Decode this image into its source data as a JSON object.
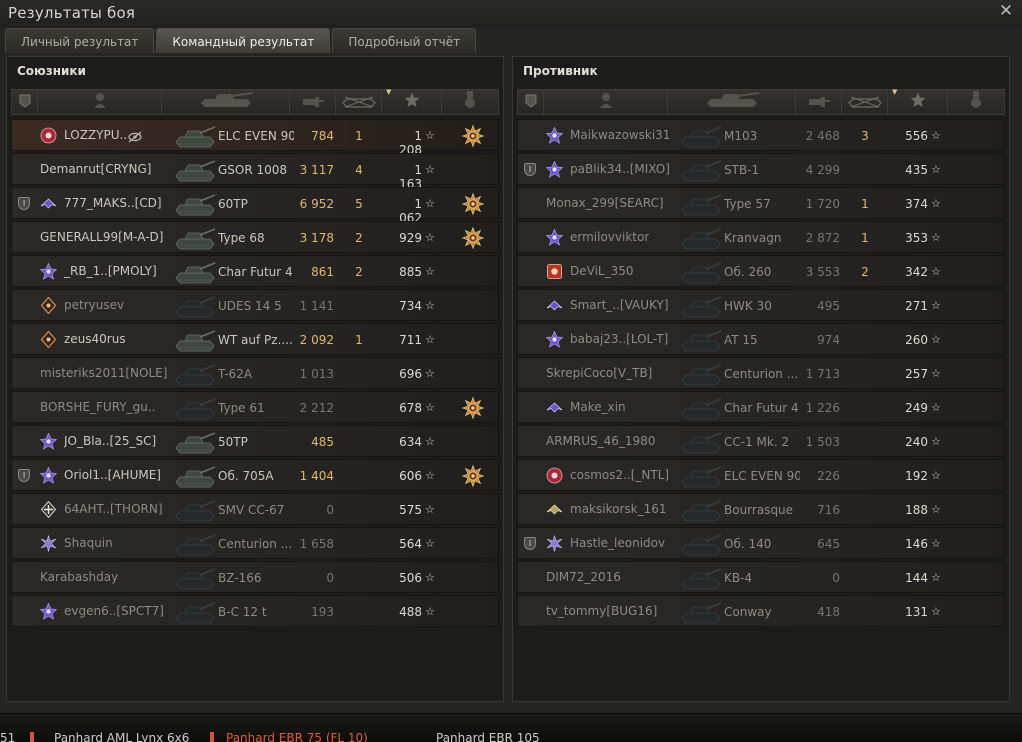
{
  "window": {
    "title": "Результаты боя"
  },
  "tabs": [
    {
      "label": "Личный результат",
      "active": false
    },
    {
      "label": "Командный результат",
      "active": true
    },
    {
      "label": "Подробный отчёт",
      "active": false
    }
  ],
  "allies": {
    "title": "Союзники",
    "players": [
      {
        "name": "LOZZYPU..",
        "squad": false,
        "rank": "red-circle",
        "tank": "ELC EVEN 90",
        "damage": "784",
        "kills": "1",
        "xp": "1 208",
        "medal": true,
        "dead": false,
        "player": true,
        "muted": true
      },
      {
        "name": "Demanrut[CRYNG]",
        "squad": false,
        "rank": "",
        "tank": "GSOR 1008",
        "damage": "3 117",
        "kills": "4",
        "xp": "1 163",
        "medal": false,
        "dead": false,
        "player": false
      },
      {
        "name": "777_MAKS..[CD]",
        "squad": true,
        "rank": "purple-wings",
        "tank": "60TP",
        "damage": "6 952",
        "kills": "5",
        "xp": "1 062",
        "medal": true,
        "dead": false,
        "player": false
      },
      {
        "name": "GENERALL99[M-A-D]",
        "squad": false,
        "rank": "",
        "tank": "Type 68",
        "damage": "3 178",
        "kills": "2",
        "xp": "929",
        "medal": true,
        "dead": false,
        "player": false
      },
      {
        "name": "_RB_1..[PMOLY]",
        "squad": false,
        "rank": "purple-star",
        "tank": "Char Futur 4",
        "damage": "861",
        "kills": "2",
        "xp": "885",
        "medal": false,
        "dead": false,
        "player": false
      },
      {
        "name": "petryusev",
        "squad": false,
        "rank": "orange-diamond",
        "tank": "UDES 14 5",
        "damage": "1 141",
        "kills": "",
        "xp": "734",
        "medal": false,
        "dead": true,
        "player": false
      },
      {
        "name": "zeus40rus",
        "squad": false,
        "rank": "orange-diamond",
        "tank": "WT auf Pz....",
        "damage": "2 092",
        "kills": "1",
        "xp": "711",
        "medal": false,
        "dead": false,
        "player": false
      },
      {
        "name": "misteriks2011[NOLE]",
        "squad": false,
        "rank": "",
        "tank": "T-62A",
        "damage": "1 013",
        "kills": "",
        "xp": "696",
        "medal": false,
        "dead": true,
        "player": false
      },
      {
        "name": "BORSHE_FURY_gu..",
        "squad": false,
        "rank": "",
        "tank": "Type 61",
        "damage": "2 212",
        "kills": "",
        "xp": "678",
        "medal": true,
        "dead": true,
        "player": false
      },
      {
        "name": "JO_Bla..[25_SC]",
        "squad": false,
        "rank": "purple-star",
        "tank": "50TP",
        "damage": "485",
        "kills": "",
        "xp": "634",
        "medal": false,
        "dead": false,
        "player": false
      },
      {
        "name": "Oriol1..[AHUME]",
        "squad": true,
        "rank": "purple-star",
        "tank": "Об. 705А",
        "damage": "1 404",
        "kills": "",
        "xp": "606",
        "medal": true,
        "dead": false,
        "player": false
      },
      {
        "name": "64AHT..[THORN]",
        "squad": false,
        "rank": "white-cross",
        "tank": "SMV CC-67",
        "damage": "0",
        "kills": "",
        "xp": "575",
        "medal": false,
        "dead": true,
        "player": false
      },
      {
        "name": "Shaquin",
        "squad": false,
        "rank": "purple-burst",
        "tank": "Centurion ...",
        "damage": "1 658",
        "kills": "",
        "xp": "564",
        "medal": false,
        "dead": true,
        "player": false
      },
      {
        "name": "Karabashday",
        "squad": false,
        "rank": "",
        "tank": "BZ-166",
        "damage": "0",
        "kills": "",
        "xp": "506",
        "medal": false,
        "dead": true,
        "player": false
      },
      {
        "name": "evgen6..[SPCT7]",
        "squad": false,
        "rank": "purple-star",
        "tank": "B-C 12 t",
        "damage": "193",
        "kills": "",
        "xp": "488",
        "medal": false,
        "dead": true,
        "player": false
      }
    ]
  },
  "enemies": {
    "title": "Противник",
    "players": [
      {
        "name": "Maikwazowski31",
        "squad": false,
        "rank": "purple-star",
        "tank": "M103",
        "damage": "2 468",
        "kills": "3",
        "xp": "556",
        "medal": false,
        "dead": true,
        "player": false
      },
      {
        "name": "paBlik34..[MIXO]",
        "squad": true,
        "rank": "purple-star",
        "tank": "STB-1",
        "damage": "4 299",
        "kills": "",
        "xp": "435",
        "medal": false,
        "dead": true,
        "player": false
      },
      {
        "name": "Monax_299[SEARC]",
        "squad": false,
        "rank": "",
        "tank": "Type 57",
        "damage": "1 720",
        "kills": "1",
        "xp": "374",
        "medal": false,
        "dead": true,
        "player": false
      },
      {
        "name": "ermilovviktor",
        "squad": false,
        "rank": "purple-star",
        "tank": "Kranvagn",
        "damage": "2 872",
        "kills": "1",
        "xp": "353",
        "medal": false,
        "dead": true,
        "player": false
      },
      {
        "name": "DeViL_350",
        "squad": false,
        "rank": "red-square",
        "tank": "Об. 260",
        "damage": "3 553",
        "kills": "2",
        "xp": "342",
        "medal": false,
        "dead": true,
        "player": false
      },
      {
        "name": "Smart_..[VAUKY]",
        "squad": false,
        "rank": "purple-wings",
        "tank": "HWK 30",
        "damage": "495",
        "kills": "",
        "xp": "271",
        "medal": false,
        "dead": true,
        "player": false
      },
      {
        "name": "babaj23..[LOL-T]",
        "squad": false,
        "rank": "purple-star",
        "tank": "AT 15",
        "damage": "974",
        "kills": "",
        "xp": "260",
        "medal": false,
        "dead": true,
        "player": false
      },
      {
        "name": "SkrepiCoco[V_TB]",
        "squad": false,
        "rank": "",
        "tank": "Centurion ...",
        "damage": "1 713",
        "kills": "",
        "xp": "257",
        "medal": false,
        "dead": true,
        "player": false
      },
      {
        "name": "Make_xin",
        "squad": false,
        "rank": "purple-wings",
        "tank": "Char Futur 4",
        "damage": "1 226",
        "kills": "",
        "xp": "249",
        "medal": false,
        "dead": true,
        "player": false
      },
      {
        "name": "ARMRUS_46_1980",
        "squad": false,
        "rank": "",
        "tank": "CC-1 Mk. 2",
        "damage": "1 503",
        "kills": "",
        "xp": "240",
        "medal": false,
        "dead": true,
        "player": false
      },
      {
        "name": "cosmos2..[_NTL]",
        "squad": false,
        "rank": "red-circle",
        "tank": "ELC EVEN 90",
        "damage": "226",
        "kills": "",
        "xp": "192",
        "medal": false,
        "dead": true,
        "player": false
      },
      {
        "name": "maksikorsk_161",
        "squad": false,
        "rank": "gold-wings",
        "tank": "Bourrasque",
        "damage": "716",
        "kills": "",
        "xp": "188",
        "medal": false,
        "dead": true,
        "player": false
      },
      {
        "name": "Hastle_leonidov",
        "squad": true,
        "rank": "purple-burst",
        "tank": "Об. 140",
        "damage": "645",
        "kills": "",
        "xp": "146",
        "medal": false,
        "dead": true,
        "player": false
      },
      {
        "name": "DIM72_2016",
        "squad": false,
        "rank": "",
        "tank": "KB-4",
        "damage": "0",
        "kills": "",
        "xp": "144",
        "medal": false,
        "dead": true,
        "player": false
      },
      {
        "name": "tv_tommy[BUG16]",
        "squad": false,
        "rank": "",
        "tank": "Conway",
        "damage": "418",
        "kills": "",
        "xp": "131",
        "medal": false,
        "dead": true,
        "player": false
      }
    ]
  },
  "bottom_strip": {
    "items": [
      "Panhard AML Lynx 6x6",
      "Panhard EBR 75 (FL 10)",
      "Panhard EBR 105"
    ],
    "left_fragment": "51"
  },
  "colors": {
    "damage": "#e0b86f",
    "damage_dead": "#797670",
    "accent": "#d9c78a"
  }
}
